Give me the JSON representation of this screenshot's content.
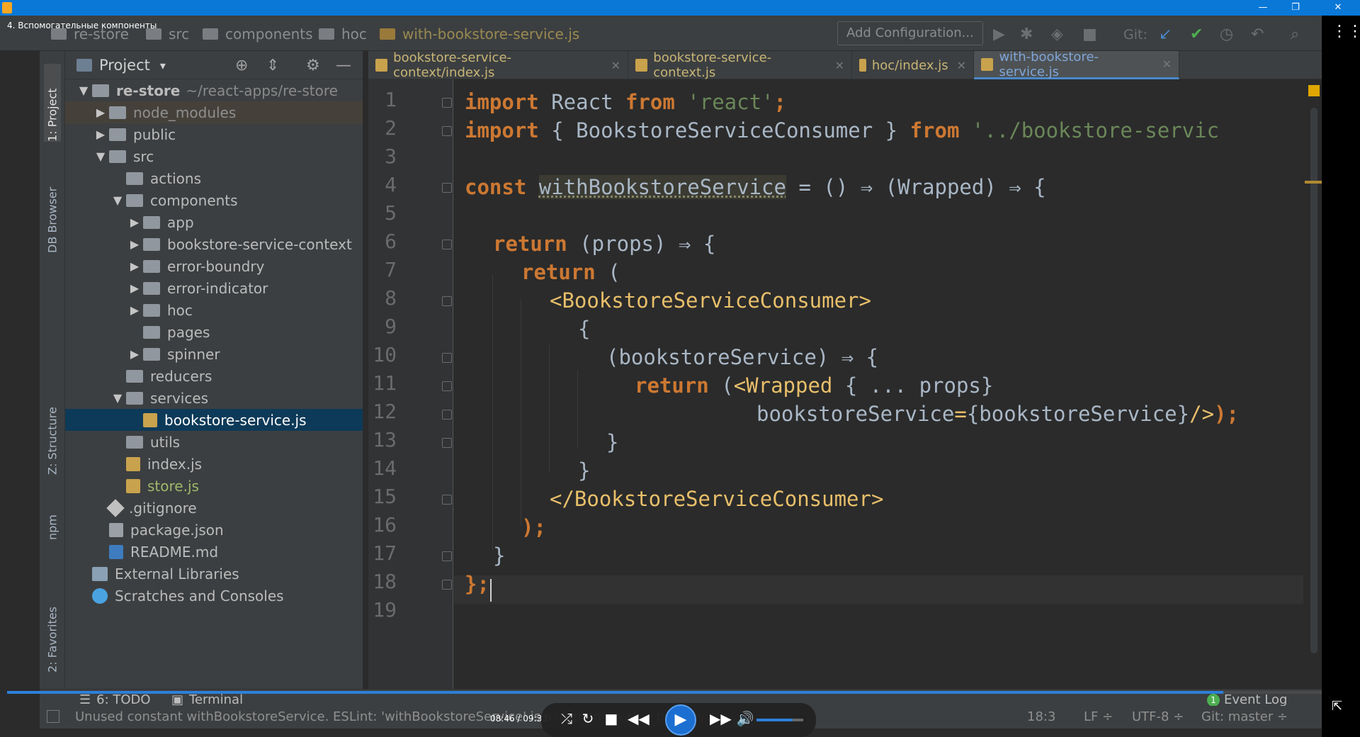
{
  "window": {
    "video_title": "4. Вспомогательные компоненты",
    "minimize_glyph": "—",
    "restore_glyph": "❐",
    "close_glyph": "✕"
  },
  "navbar": {
    "crumbs": [
      "re-store",
      "src",
      "components",
      "hoc",
      "with-bookstore-service.js"
    ],
    "add_configuration": "Add Configuration...",
    "git_label": "Git:"
  },
  "toolstrip": {
    "project": "1: Project",
    "db_browser": "DB Browser",
    "structure": "Z: Structure",
    "npm": "npm",
    "favorites": "2: Favorites"
  },
  "project_panel": {
    "title": "Project",
    "dropdown_glyph": "▾"
  },
  "tree": [
    {
      "label": "re-store",
      "hint": "~/react-apps/re-store",
      "arrow": "▼",
      "icon": "folder",
      "depth": 0
    },
    {
      "label": "node_modules",
      "hint": "",
      "arrow": "▶",
      "icon": "folder",
      "depth": 1
    },
    {
      "label": "public",
      "hint": "",
      "arrow": "▶",
      "icon": "folder",
      "depth": 1
    },
    {
      "label": "src",
      "hint": "",
      "arrow": "▼",
      "icon": "folder",
      "depth": 1
    },
    {
      "label": "actions",
      "hint": "",
      "arrow": "",
      "icon": "folder",
      "depth": 2
    },
    {
      "label": "components",
      "hint": "",
      "arrow": "▼",
      "icon": "folder",
      "depth": 2
    },
    {
      "label": "app",
      "hint": "",
      "arrow": "▶",
      "icon": "folder",
      "depth": 3
    },
    {
      "label": "bookstore-service-context",
      "hint": "",
      "arrow": "▶",
      "icon": "folder",
      "depth": 3
    },
    {
      "label": "error-boundry",
      "hint": "",
      "arrow": "▶",
      "icon": "folder",
      "depth": 3
    },
    {
      "label": "error-indicator",
      "hint": "",
      "arrow": "▶",
      "icon": "folder",
      "depth": 3
    },
    {
      "label": "hoc",
      "hint": "",
      "arrow": "▶",
      "icon": "folder",
      "depth": 3
    },
    {
      "label": "pages",
      "hint": "",
      "arrow": "",
      "icon": "folder",
      "depth": 3
    },
    {
      "label": "spinner",
      "hint": "",
      "arrow": "▶",
      "icon": "folder",
      "depth": 3
    },
    {
      "label": "reducers",
      "hint": "",
      "arrow": "",
      "icon": "folder",
      "depth": 2
    },
    {
      "label": "services",
      "hint": "",
      "arrow": "▼",
      "icon": "folder",
      "depth": 2
    },
    {
      "label": "bookstore-service.js",
      "hint": "",
      "arrow": "",
      "icon": "js",
      "depth": 3
    },
    {
      "label": "utils",
      "hint": "",
      "arrow": "",
      "icon": "folder",
      "depth": 2
    },
    {
      "label": "index.js",
      "hint": "",
      "arrow": "",
      "icon": "js",
      "depth": 2
    },
    {
      "label": "store.js",
      "hint": "",
      "arrow": "",
      "icon": "js",
      "depth": 2
    },
    {
      "label": ".gitignore",
      "hint": "",
      "arrow": "",
      "icon": "git",
      "depth": 1
    },
    {
      "label": "package.json",
      "hint": "",
      "arrow": "",
      "icon": "json",
      "depth": 1
    },
    {
      "label": "README.md",
      "hint": "",
      "arrow": "",
      "icon": "md",
      "depth": 1
    },
    {
      "label": "External Libraries",
      "hint": "",
      "arrow": "",
      "icon": "lib",
      "depth": 0
    },
    {
      "label": "Scratches and Consoles",
      "hint": "",
      "arrow": "",
      "icon": "scratch",
      "depth": 0
    }
  ],
  "tabs": [
    {
      "label": "bookstore-service-context/index.js",
      "close": "✕"
    },
    {
      "label": "bookstore-service-context.js",
      "close": "✕"
    },
    {
      "label": "hoc/index.js",
      "close": "✕"
    },
    {
      "label": "with-bookstore-service.js",
      "close": "✕"
    }
  ],
  "editor": {
    "line_numbers": [
      "1",
      "2",
      "3",
      "4",
      "5",
      "6",
      "7",
      "8",
      "9",
      "10",
      "11",
      "12",
      "13",
      "14",
      "15",
      "16",
      "17",
      "18",
      "19"
    ],
    "code": {
      "l1": {
        "kw1": "import",
        "t1": " React ",
        "kw2": "from",
        "t2": " ",
        "s1": "'react'",
        "t3": ";"
      },
      "l2": {
        "kw1": "import",
        "t1": " { BookstoreServiceConsumer } ",
        "kw2": "from",
        "t2": " ",
        "s1": "'../bookstore-servic"
      },
      "l4": {
        "kw1": "const",
        "t0": " ",
        "hl": "withBookstoreService",
        "t1": " = () ⇒ (Wrapped) ⇒ {"
      },
      "l6": {
        "kw1": "return",
        "t1": " (props) ⇒ {"
      },
      "l7": {
        "kw1": "return",
        "t1": " ("
      },
      "l8": {
        "tag": "<BookstoreServiceConsumer>"
      },
      "l9": {
        "t1": "{"
      },
      "l10": {
        "t1": "(bookstoreService) ⇒ {"
      },
      "l11": {
        "kw1": "return",
        "t1": " (",
        "tag": "<Wrapped",
        "t2": " { ... props}"
      },
      "l12": {
        "t1": "bookstoreService",
        "t2": "=",
        "t3": "{bookstoreService}",
        "tag": "/>",
        "t4": ");"
      },
      "l13": {
        "t1": "}"
      },
      "l14": {
        "t1": "}"
      },
      "l15": {
        "tag": "</BookstoreServiceConsumer>"
      },
      "l16": {
        "t1": ");"
      },
      "l17": {
        "t1": "}"
      },
      "l18": {
        "t1": "};"
      }
    }
  },
  "bottombar": {
    "todo": "6: TODO",
    "terminal": "Terminal",
    "event_log": "Event Log",
    "event_count": "1"
  },
  "statusbar": {
    "message": "Unused constant withBookstoreService. ESLint: 'withBookstoreService' is assigned a value but never used. (no-unused-vars)",
    "position": "18:3",
    "line_ending": "LF ÷",
    "encoding": "UTF-8 ÷",
    "git_branch": "Git: master ÷"
  },
  "player": {
    "time": "08:46 / 09:33",
    "progress": 0.918,
    "volume": 0.78
  },
  "colors": {
    "accent": "#2d7fd8",
    "keyword": "#cc7832",
    "string": "#6a8759",
    "tag": "#e8bf6a"
  }
}
